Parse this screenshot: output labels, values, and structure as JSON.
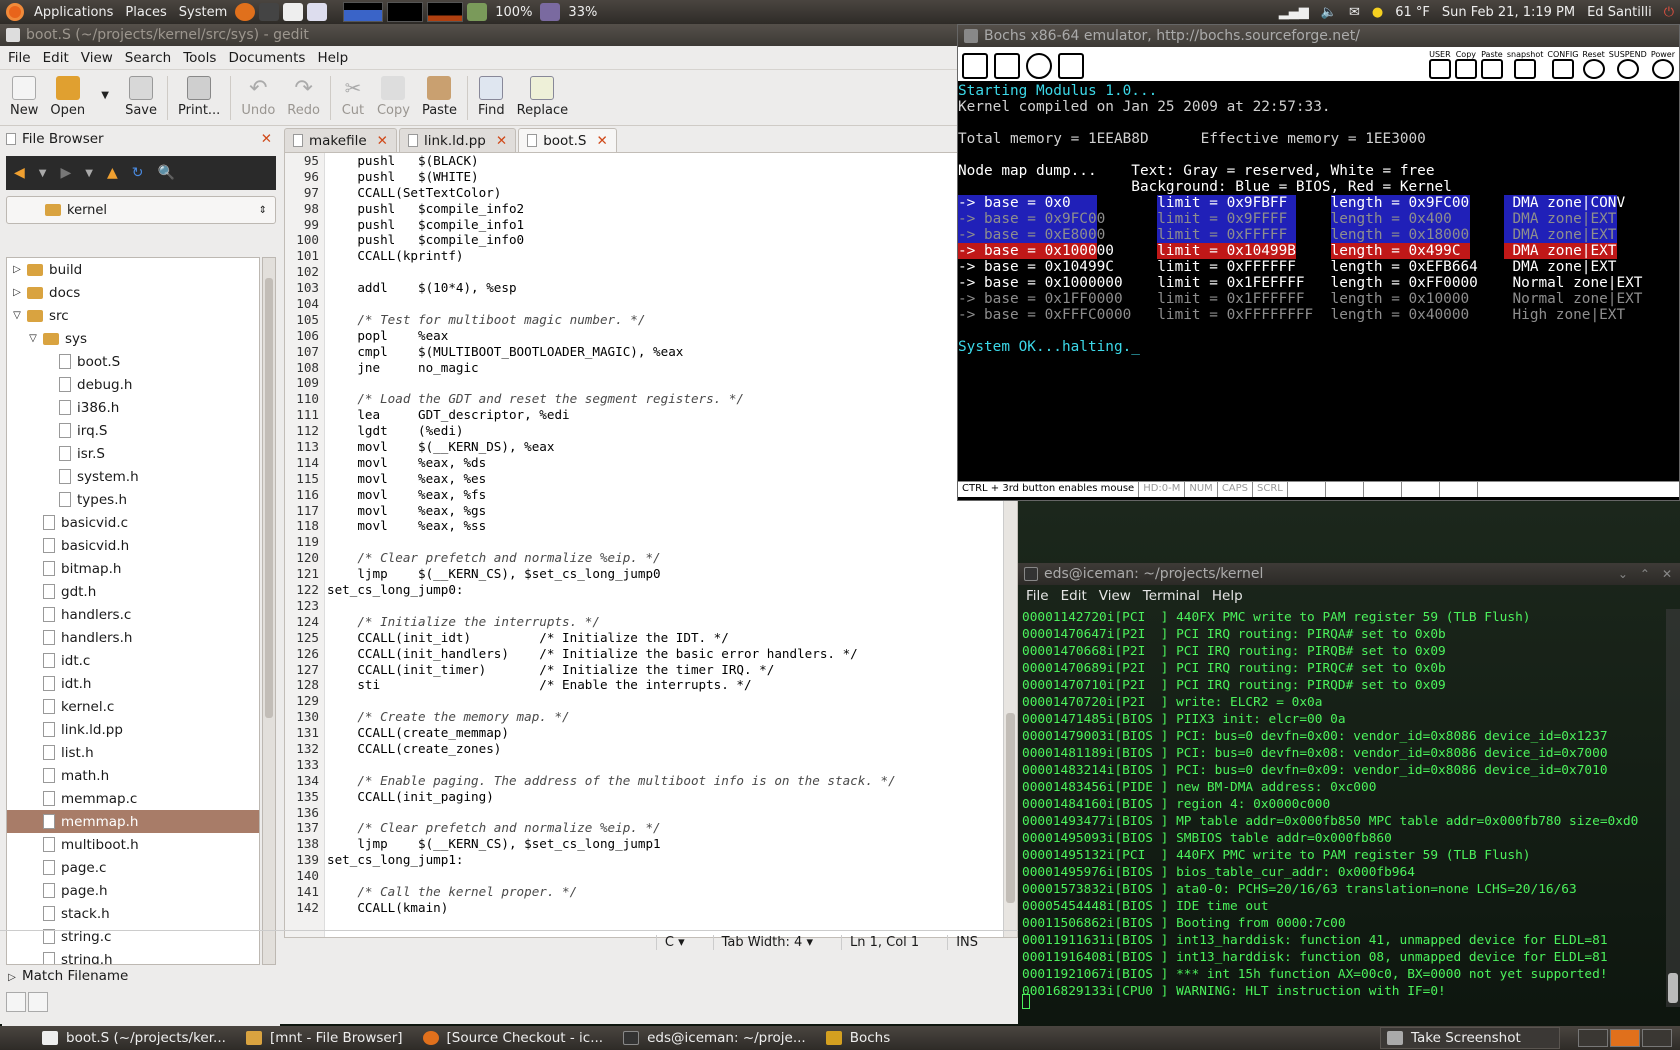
{
  "top_panel": {
    "menus": [
      "Applications",
      "Places",
      "System"
    ],
    "battery": "100%",
    "cpu": "33%",
    "weather": "61 °F",
    "clock": "Sun Feb 21,  1:19 PM",
    "user": "Ed Santilli"
  },
  "gedit": {
    "title": "boot.S (~/projects/kernel/src/sys) - gedit",
    "menu": [
      "File",
      "Edit",
      "View",
      "Search",
      "Tools",
      "Documents",
      "Help"
    ],
    "toolbar": {
      "new": "New",
      "open": "Open",
      "save": "Save",
      "print": "Print...",
      "undo": "Undo",
      "redo": "Redo",
      "cut": "Cut",
      "copy": "Copy",
      "paste": "Paste",
      "find": "Find",
      "replace": "Replace"
    },
    "side_pane": {
      "title": "File Browser",
      "location": "kernel",
      "tree": [
        {
          "label": "build",
          "type": "folder",
          "depth": 0,
          "expander": "▷"
        },
        {
          "label": "docs",
          "type": "folder",
          "depth": 0,
          "expander": "▷"
        },
        {
          "label": "src",
          "type": "folder",
          "depth": 0,
          "expander": "▽"
        },
        {
          "label": "sys",
          "type": "folder",
          "depth": 1,
          "expander": "▽"
        },
        {
          "label": "boot.S",
          "type": "file",
          "depth": 2
        },
        {
          "label": "debug.h",
          "type": "file",
          "depth": 2
        },
        {
          "label": "i386.h",
          "type": "file",
          "depth": 2
        },
        {
          "label": "irq.S",
          "type": "file",
          "depth": 2
        },
        {
          "label": "isr.S",
          "type": "file",
          "depth": 2
        },
        {
          "label": "system.h",
          "type": "file",
          "depth": 2
        },
        {
          "label": "types.h",
          "type": "file",
          "depth": 2
        },
        {
          "label": "basicvid.c",
          "type": "file",
          "depth": 1
        },
        {
          "label": "basicvid.h",
          "type": "file",
          "depth": 1
        },
        {
          "label": "bitmap.h",
          "type": "file",
          "depth": 1
        },
        {
          "label": "gdt.h",
          "type": "file",
          "depth": 1
        },
        {
          "label": "handlers.c",
          "type": "file",
          "depth": 1
        },
        {
          "label": "handlers.h",
          "type": "file",
          "depth": 1
        },
        {
          "label": "idt.c",
          "type": "file",
          "depth": 1
        },
        {
          "label": "idt.h",
          "type": "file",
          "depth": 1
        },
        {
          "label": "kernel.c",
          "type": "file",
          "depth": 1
        },
        {
          "label": "link.ld.pp",
          "type": "file",
          "depth": 1
        },
        {
          "label": "list.h",
          "type": "file",
          "depth": 1
        },
        {
          "label": "math.h",
          "type": "file",
          "depth": 1
        },
        {
          "label": "memmap.c",
          "type": "file",
          "depth": 1
        },
        {
          "label": "memmap.h",
          "type": "file",
          "depth": 1,
          "selected": true
        },
        {
          "label": "multiboot.h",
          "type": "file",
          "depth": 1
        },
        {
          "label": "page.c",
          "type": "file",
          "depth": 1
        },
        {
          "label": "page.h",
          "type": "file",
          "depth": 1
        },
        {
          "label": "stack.h",
          "type": "file",
          "depth": 1
        },
        {
          "label": "string.c",
          "type": "file",
          "depth": 1
        },
        {
          "label": "string.h",
          "type": "file",
          "depth": 1
        }
      ],
      "match_filename": "Match Filename"
    },
    "tabs": [
      "makefile",
      "link.ld.pp",
      "boot.S"
    ],
    "active_tab": 2,
    "code": [
      {
        "n": "95",
        "text": "    pushl   $(BLACK)"
      },
      {
        "n": "96",
        "text": "    pushl   $(WHITE)"
      },
      {
        "n": "97",
        "text": "    CCALL(SetTextColor)"
      },
      {
        "n": "98",
        "text": "    pushl   $compile_info2"
      },
      {
        "n": "99",
        "text": "    pushl   $compile_info1"
      },
      {
        "n": "100",
        "text": "    pushl   $compile_info0"
      },
      {
        "n": "101",
        "text": "    CCALL(kprintf)"
      },
      {
        "n": "102",
        "text": ""
      },
      {
        "n": "103",
        "text": "    addl    $(10*4), %esp"
      },
      {
        "n": "104",
        "text": ""
      },
      {
        "n": "105",
        "text": "    /* Test for multiboot magic number. */",
        "comment": true
      },
      {
        "n": "106",
        "text": "    popl    %eax"
      },
      {
        "n": "107",
        "text": "    cmpl    $(MULTIBOOT_BOOTLOADER_MAGIC), %eax"
      },
      {
        "n": "108",
        "text": "    jne     no_magic"
      },
      {
        "n": "109",
        "text": ""
      },
      {
        "n": "110",
        "text": "    /* Load the GDT and reset the segment registers. */",
        "comment": true
      },
      {
        "n": "111",
        "text": "    lea     GDT_descriptor, %edi"
      },
      {
        "n": "112",
        "text": "    lgdt    (%edi)"
      },
      {
        "n": "113",
        "text": "    movl    $(__KERN_DS), %eax"
      },
      {
        "n": "114",
        "text": "    movl    %eax, %ds"
      },
      {
        "n": "115",
        "text": "    movl    %eax, %es"
      },
      {
        "n": "116",
        "text": "    movl    %eax, %fs"
      },
      {
        "n": "117",
        "text": "    movl    %eax, %gs"
      },
      {
        "n": "118",
        "text": "    movl    %eax, %ss"
      },
      {
        "n": "119",
        "text": ""
      },
      {
        "n": "120",
        "text": "    /* Clear prefetch and normalize %eip. */",
        "comment": true
      },
      {
        "n": "121",
        "text": "    ljmp    $(__KERN_CS), $set_cs_long_jump0"
      },
      {
        "n": "122",
        "text": "set_cs_long_jump0:"
      },
      {
        "n": "123",
        "text": ""
      },
      {
        "n": "124",
        "text": "    /* Initialize the interrupts. */",
        "comment": true
      },
      {
        "n": "125",
        "text": "    CCALL(init_idt)         /* Initialize the IDT. */"
      },
      {
        "n": "126",
        "text": "    CCALL(init_handlers)    /* Initialize the basic error handlers. */"
      },
      {
        "n": "127",
        "text": "    CCALL(init_timer)       /* Initialize the timer IRQ. */"
      },
      {
        "n": "128",
        "text": "    sti                     /* Enable the interrupts. */"
      },
      {
        "n": "129",
        "text": ""
      },
      {
        "n": "130",
        "text": "    /* Create the memory map. */",
        "comment": true
      },
      {
        "n": "131",
        "text": "    CCALL(create_memmap)"
      },
      {
        "n": "132",
        "text": "    CCALL(create_zones)"
      },
      {
        "n": "133",
        "text": ""
      },
      {
        "n": "134",
        "text": "    /* Enable paging. The address of the multiboot info is on the stack. */",
        "comment": true
      },
      {
        "n": "135",
        "text": "    CCALL(init_paging)"
      },
      {
        "n": "136",
        "text": ""
      },
      {
        "n": "137",
        "text": "    /* Clear prefetch and normalize %eip. */",
        "comment": true
      },
      {
        "n": "138",
        "text": "    ljmp    $(__KERN_CS), $set_cs_long_jump1"
      },
      {
        "n": "139",
        "text": "set_cs_long_jump1:"
      },
      {
        "n": "140",
        "text": ""
      },
      {
        "n": "141",
        "text": "    /* Call the kernel proper. */",
        "comment": true
      },
      {
        "n": "142",
        "text": "    CCALL(kmain)"
      }
    ],
    "status": {
      "language": "C",
      "tab_width": "Tab Width: 4",
      "position": "Ln 1, Col 1",
      "mode": "INS"
    }
  },
  "bochs": {
    "title": "Bochs x86-64 emulator, http://bochs.sourceforge.net/",
    "toolbar_labels": [
      "USER",
      "Copy",
      "Paste",
      "snapshot",
      "CONFIG",
      "Reset",
      "SUSPEND",
      "Power"
    ],
    "screen": [
      {
        "text": "Starting Modulus 1.0...",
        "style": "cyan"
      },
      {
        "text": "Kernel compiled on Jan 25 2009 at 22:57:33.",
        "style": "plain"
      },
      {
        "text": "",
        "style": "plain"
      },
      {
        "text": "Total memory = 1EEAB8D      Effective memory = 1EE3000",
        "style": "plain"
      },
      {
        "text": "",
        "style": "plain"
      },
      {
        "text": "Node map dump...    Text: Gray = reserved, White = free",
        "style": "white"
      },
      {
        "text": "                    Background: Blue = BIOS, Red = Kernel",
        "style": "white"
      },
      {
        "text": "-> base = 0x0          limit = 0x9FBFF     length = 0x9FC00     DMA zone|CONV",
        "style": "white",
        "bg": "blue"
      },
      {
        "text": "-> base = 0x9FC00      limit = 0x9FFFF     length = 0x400       DMA zone|EXT",
        "style": "gray",
        "bg": "blue"
      },
      {
        "text": "-> base = 0xE8000      limit = 0xFFFFF     length = 0x18000     DMA zone|EXT",
        "style": "gray",
        "bg": "blue"
      },
      {
        "text": "-> base = 0x100000     limit = 0x10499B    length = 0x499C      DMA zone|EXT",
        "style": "white",
        "bg": "red"
      },
      {
        "text": "-> base = 0x10499C     limit = 0xFFFFFF    length = 0xEFB664    DMA zone|EXT",
        "style": "white"
      },
      {
        "text": "-> base = 0x1000000    limit = 0x1FEFFFF   length = 0xFF0000    Normal zone|EXT",
        "style": "white"
      },
      {
        "text": "-> base = 0x1FF0000    limit = 0x1FFFFFF   length = 0x10000     Normal zone|EXT",
        "style": "gray"
      },
      {
        "text": "-> base = 0xFFFC0000   limit = 0xFFFFFFFF  length = 0x40000     High zone|EXT",
        "style": "gray"
      },
      {
        "text": "",
        "style": "plain"
      },
      {
        "text": "System OK...halting._",
        "style": "cyan"
      }
    ],
    "status": [
      "CTRL + 3rd button enables mouse",
      "HD:0-M",
      "NUM",
      "CAPS",
      "SCRL",
      "",
      "",
      "",
      "",
      ""
    ]
  },
  "terminal": {
    "title": "eds@iceman: ~/projects/kernel",
    "menu": [
      "File",
      "Edit",
      "View",
      "Terminal",
      "Help"
    ],
    "lines": [
      "00001142720i[PCI  ] 440FX PMC write to PAM register 59 (TLB Flush)",
      "00001470647i[P2I  ] PCI IRQ routing: PIRQA# set to 0x0b",
      "00001470668i[P2I  ] PCI IRQ routing: PIRQB# set to 0x09",
      "00001470689i[P2I  ] PCI IRQ routing: PIRQC# set to 0x0b",
      "00001470710i[P2I  ] PCI IRQ routing: PIRQD# set to 0x09",
      "00001470720i[P2I  ] write: ELCR2 = 0x0a",
      "00001471485i[BIOS ] PIIX3 init: elcr=00 0a",
      "00001479003i[BIOS ] PCI: bus=0 devfn=0x00: vendor_id=0x8086 device_id=0x1237",
      "00001481189i[BIOS ] PCI: bus=0 devfn=0x08: vendor_id=0x8086 device_id=0x7000",
      "00001483214i[BIOS ] PCI: bus=0 devfn=0x09: vendor_id=0x8086 device_id=0x7010",
      "00001483456i[PIDE ] new BM-DMA address: 0xc000",
      "00001484160i[BIOS ] region 4: 0x0000c000",
      "00001493477i[BIOS ] MP table addr=0x000fb850 MPC table addr=0x000fb780 size=0xd0",
      "00001495093i[BIOS ] SMBIOS table addr=0x000fb860",
      "00001495132i[PCI  ] 440FX PMC write to PAM register 59 (TLB Flush)",
      "00001495976i[BIOS ] bios_table_cur_addr: 0x000fb964",
      "00001573832i[BIOS ] ata0-0: PCHS=20/16/63 translation=none LCHS=20/16/63",
      "00005454448i[BIOS ] IDE time out",
      "00011506862i[BIOS ] Booting from 0000:7c00",
      "00011911631i[BIOS ] int13_harddisk: function 41, unmapped device for ELDL=81",
      "00011916408i[BIOS ] int13_harddisk: function 08, unmapped device for ELDL=81",
      "00011921067i[BIOS ] *** int 15h function AX=00c0, BX=0000 not yet supported!",
      "00016829133i[CPU0 ] WARNING: HLT instruction with IF=0!",
      ""
    ]
  },
  "taskbar": {
    "tasks": [
      "boot.S (~/projects/ker...",
      "[mnt - File Browser]",
      "[Source Checkout - ic...",
      "eds@iceman: ~/proje...",
      "Bochs"
    ],
    "screenshot": "Take Screenshot"
  },
  "colors": {
    "panel": "#3a3632",
    "selection": "#a87c68",
    "terminal_text": "#4cf25c",
    "bochs_cyan": "#3cd8e8",
    "bochs_blue": "#2020b8",
    "bochs_red": "#c01818"
  }
}
